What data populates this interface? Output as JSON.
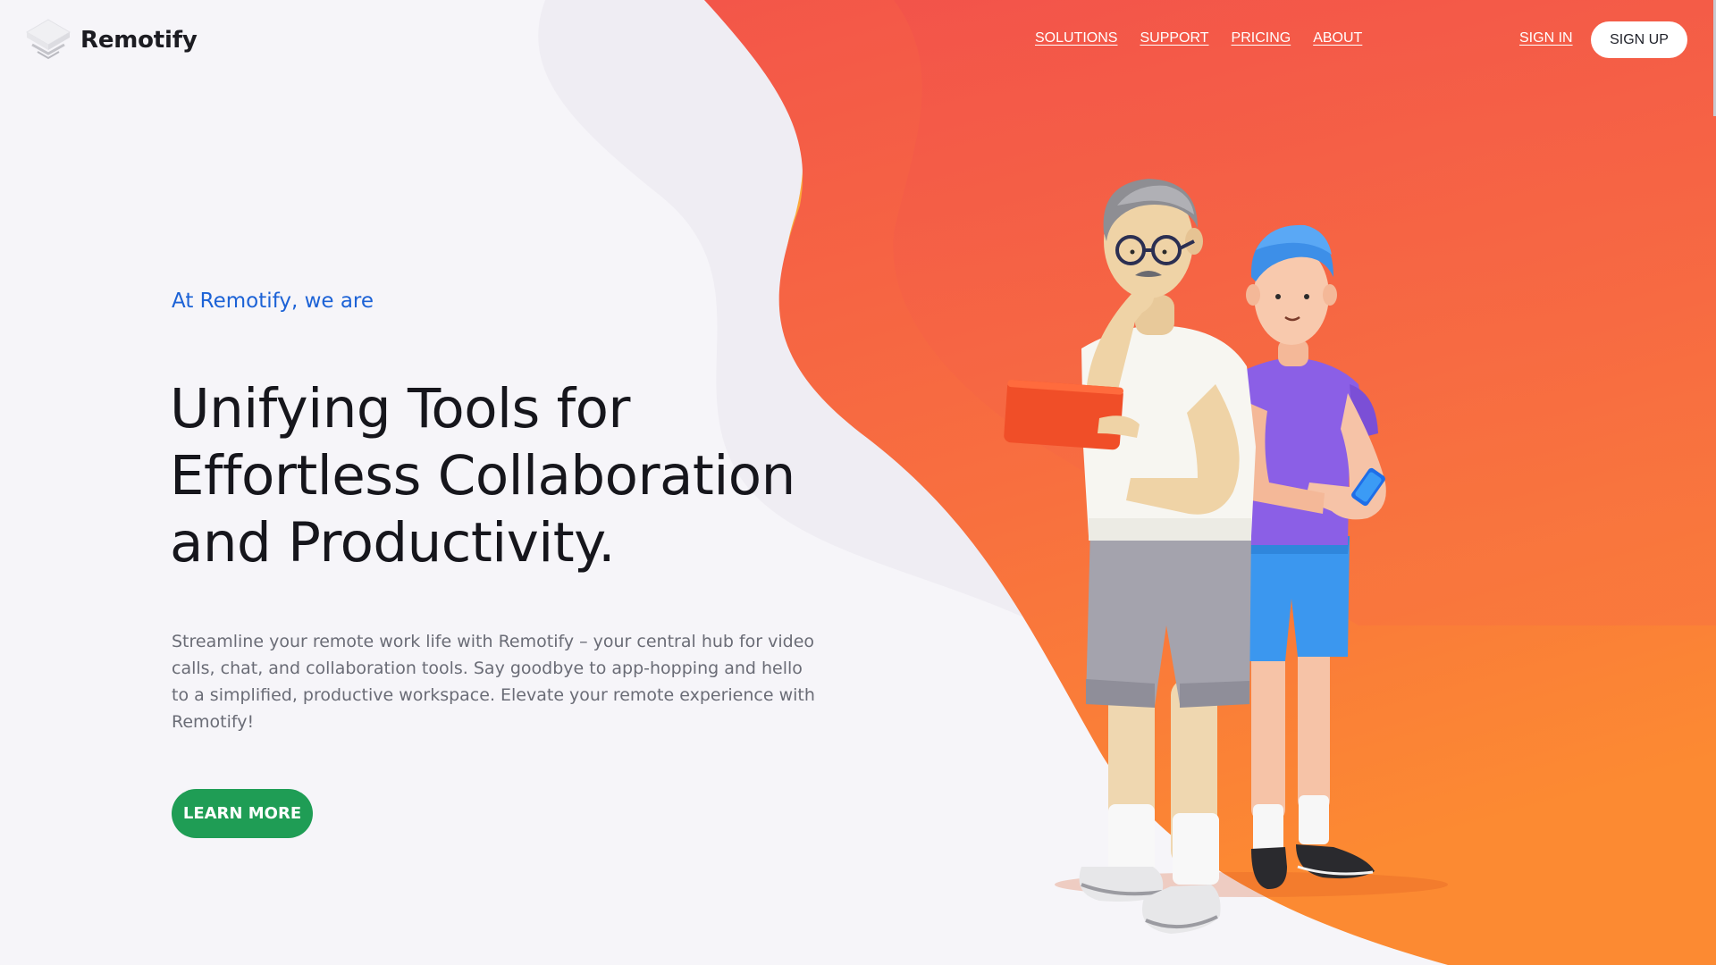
{
  "brand": {
    "name": "Remotify"
  },
  "nav": {
    "links": [
      {
        "label": "SOLUTIONS"
      },
      {
        "label": "SUPPORT"
      },
      {
        "label": "PRICING"
      },
      {
        "label": "ABOUT"
      }
    ],
    "sign_in": "SIGN IN",
    "sign_up": "SIGN UP"
  },
  "hero": {
    "eyebrow": "At Remotify, we are",
    "headline_lines": [
      "Unifying Tools for",
      "Effortless Collaboration",
      "and Productivity."
    ],
    "description": "Streamline your remote work life with Remotify – your central hub for video calls, chat, and collaboration tools. Say goodbye to app-hopping and hello to a simplified, productive workspace. Elevate your remote experience with Remotify!",
    "cta": "LEARN MORE"
  },
  "colors": {
    "background": "#f6f5f9",
    "accent_text": "#1c62d6",
    "cta": "#1f9d55",
    "wave_red": "#f2514b",
    "wave_orange": "#fb8a34",
    "wave_yellow": "#fbbf3a"
  },
  "icons": {
    "logo": "layered-diamond-icon"
  }
}
